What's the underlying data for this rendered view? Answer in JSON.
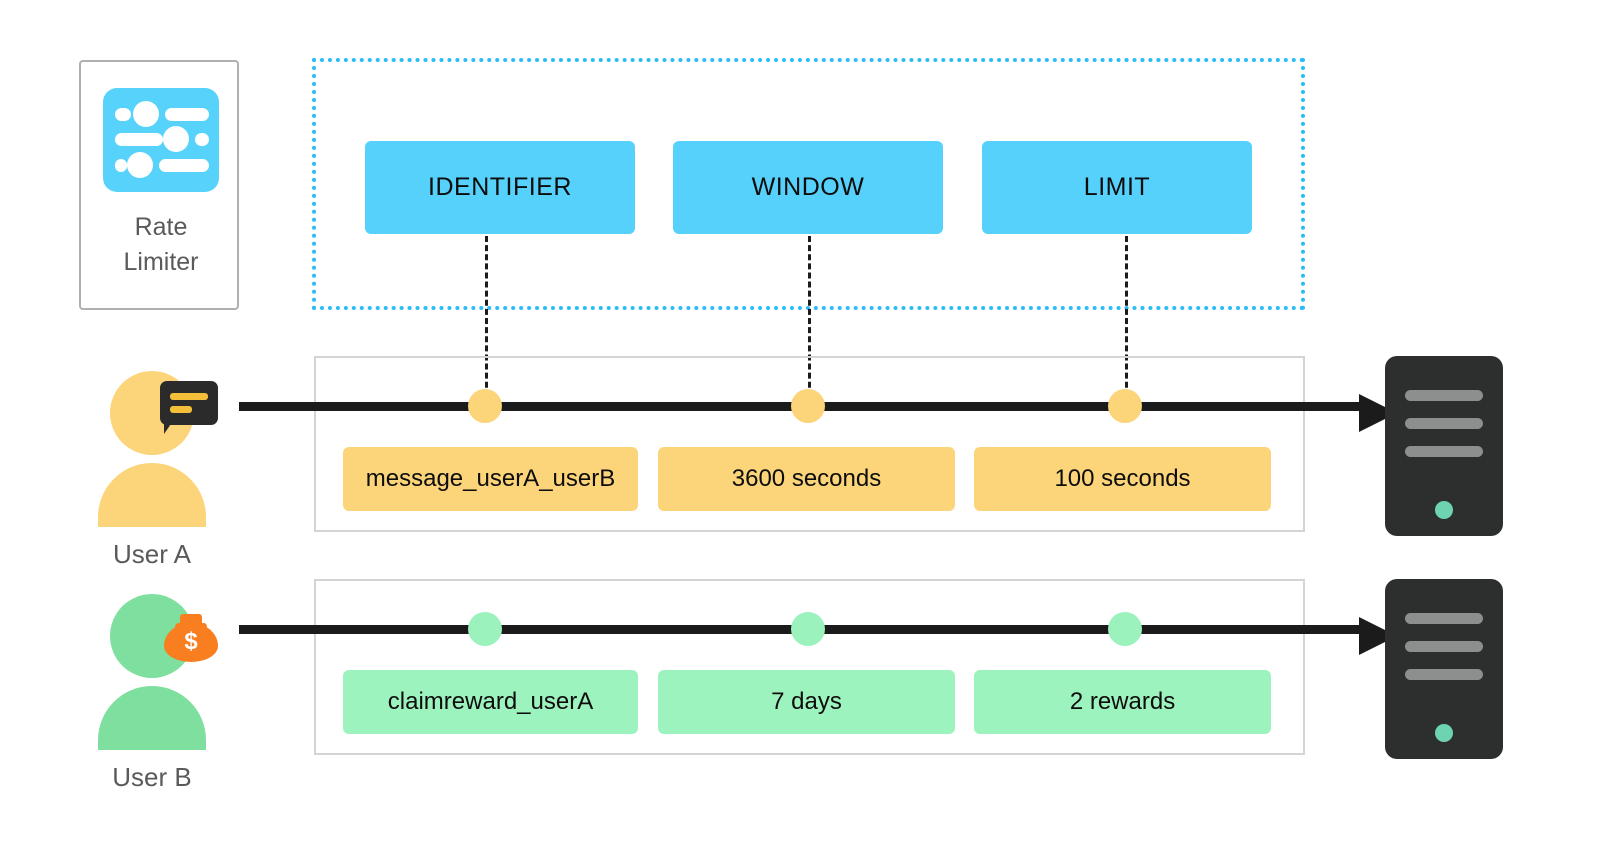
{
  "rate_limiter": {
    "label_line1": "Rate",
    "label_line2": "Limiter",
    "icon": "sliders-icon",
    "icon_color": "#57d2fb"
  },
  "config": {
    "border_color": "#29bdf7",
    "chip_color": "#55d1fb",
    "chips": [
      {
        "label": "IDENTIFIER",
        "name": "config-chip-identifier"
      },
      {
        "label": "WINDOW",
        "name": "config-chip-window"
      },
      {
        "label": "LIMIT",
        "name": "config-chip-limit"
      }
    ]
  },
  "lanes": [
    {
      "id": "lane-user-a",
      "user": {
        "name": "User A",
        "avatar_color": "#fcd479",
        "badge": "message-bubble-icon"
      },
      "node_color": "#fcd479",
      "chip_color": "#fcd479",
      "values": [
        {
          "label": "message_userA_userB",
          "name": "value-chip-identifier-a"
        },
        {
          "label": "3600 seconds",
          "name": "value-chip-window-a"
        },
        {
          "label": "100 seconds",
          "name": "value-chip-limit-a"
        }
      ],
      "server": {
        "name": "server-a",
        "led_color": "#6dd3b0"
      }
    },
    {
      "id": "lane-user-b",
      "user": {
        "name": "User B",
        "avatar_color": "#7fdf9f",
        "badge": "money-bag-icon"
      },
      "node_color": "#9bf2bc",
      "chip_color": "#9df3bd",
      "values": [
        {
          "label": "claimreward_userA",
          "name": "value-chip-identifier-b"
        },
        {
          "label": "7 days",
          "name": "value-chip-window-b"
        },
        {
          "label": "2 rewards",
          "name": "value-chip-limit-b"
        }
      ],
      "server": {
        "name": "server-b",
        "led_color": "#6dd3b0"
      }
    }
  ],
  "money_bag": {
    "symbol": "$"
  }
}
